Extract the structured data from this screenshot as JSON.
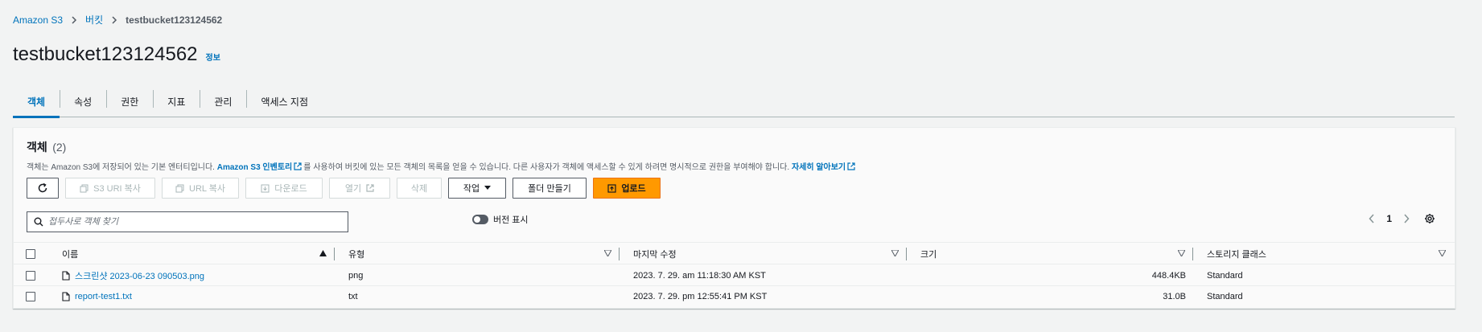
{
  "breadcrumb": {
    "root": "Amazon S3",
    "buckets": "버킷",
    "current": "testbucket123124562"
  },
  "header": {
    "title": "testbucket123124562",
    "info": "정보"
  },
  "tabs": [
    {
      "label": "객체",
      "active": true
    },
    {
      "label": "속성"
    },
    {
      "label": "권한"
    },
    {
      "label": "지표"
    },
    {
      "label": "관리"
    },
    {
      "label": "액세스 지점"
    }
  ],
  "panel": {
    "title": "객체",
    "count": "(2)",
    "desc_prefix": "객체는 Amazon S3에 저장되어 있는 기본 엔터티입니다.",
    "desc_link": "Amazon S3 인벤토리",
    "desc_middle": "를 사용하여 버킷에 있는 모든 객체의 목록을 얻을 수 있습니다. 다른 사용자가 객체에 액세스할 수 있게 하려면 명시적으로 권한을 부여해야 합니다.",
    "desc_learn": "자세히 알아보기"
  },
  "toolbar": {
    "copy_s3_uri": "S3 URI 복사",
    "copy_url": "URL 복사",
    "download": "다운로드",
    "open": "열기",
    "delete": "삭제",
    "actions": "작업",
    "create_folder": "폴더 만들기",
    "upload": "업로드"
  },
  "search": {
    "placeholder": "접두사로 객체 찾기"
  },
  "version_toggle": {
    "label": "버전 표시",
    "enabled": false
  },
  "pagination": {
    "page": "1"
  },
  "table": {
    "columns": {
      "name": "이름",
      "type": "유형",
      "modified": "마지막 수정",
      "size": "크기",
      "storage": "스토리지 클래스"
    },
    "rows": [
      {
        "name": "스크린샷 2023-06-23 090503.png",
        "type": "png",
        "modified": "2023. 7. 29. am 11:18:30 AM KST",
        "size": "448.4KB",
        "storage": "Standard"
      },
      {
        "name": "report-test1.txt",
        "type": "txt",
        "modified": "2023. 7. 29. pm 12:55:41 PM KST",
        "size": "31.0B",
        "storage": "Standard"
      }
    ]
  },
  "colors": {
    "link": "#0073bb",
    "primary": "#ff9900",
    "background": "#f2f3f3"
  }
}
